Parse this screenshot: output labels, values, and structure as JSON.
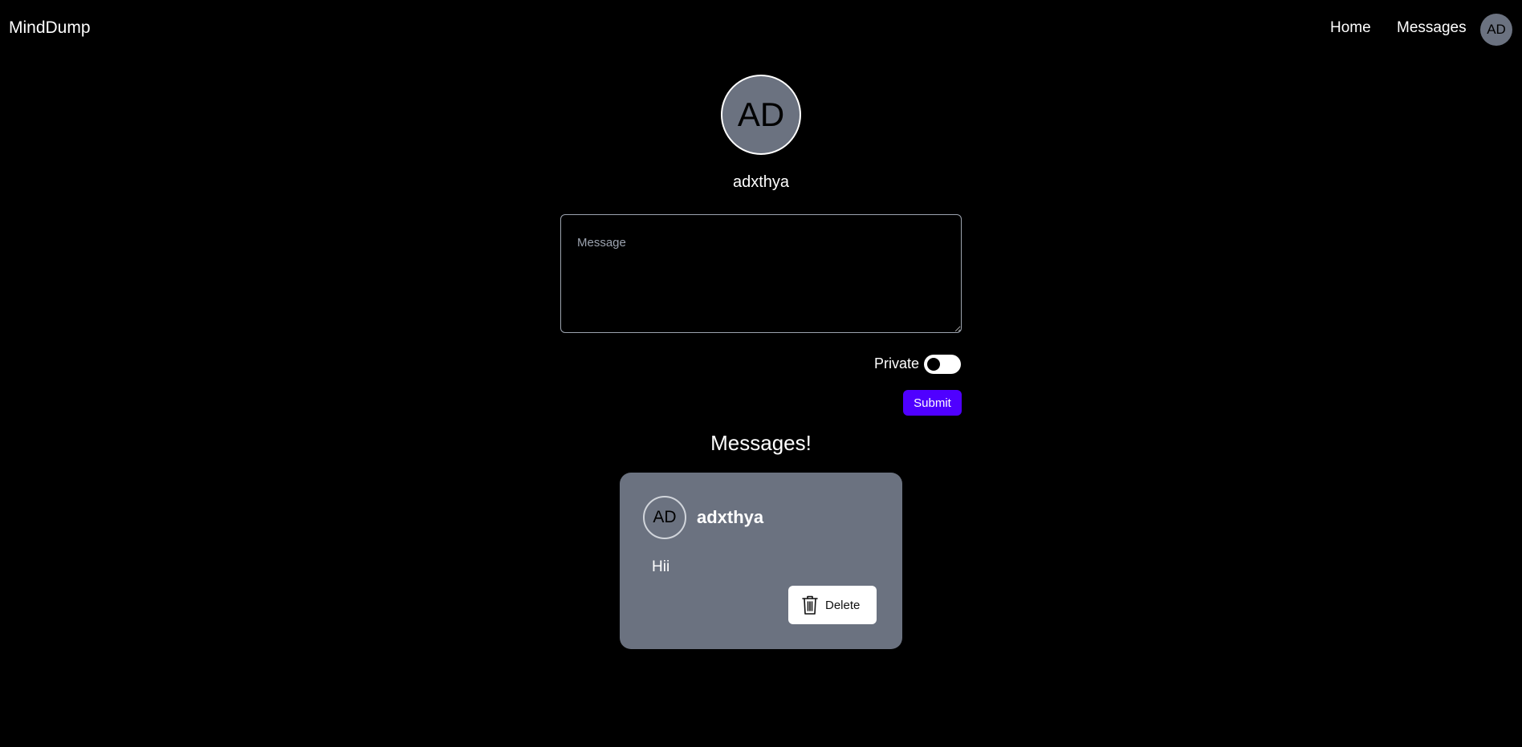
{
  "navbar": {
    "brand": "MindDump",
    "links": [
      {
        "label": "Home"
      },
      {
        "label": "Messages"
      }
    ],
    "avatar_initials": "AD"
  },
  "profile": {
    "initials": "AD",
    "username": "adxthya"
  },
  "compose": {
    "placeholder": "Message",
    "value": "",
    "private_label": "Private",
    "private_enabled": false,
    "submit_label": "Submit"
  },
  "messages_section": {
    "heading": "Messages!",
    "items": [
      {
        "initials": "AD",
        "author": "adxthya",
        "body": "Hii",
        "delete_label": "Delete"
      }
    ]
  },
  "colors": {
    "background": "#000000",
    "accent": "#4f00ff",
    "card": "#6b7280",
    "avatar": "#6b7280"
  },
  "icons": {
    "delete": "trash-icon"
  }
}
